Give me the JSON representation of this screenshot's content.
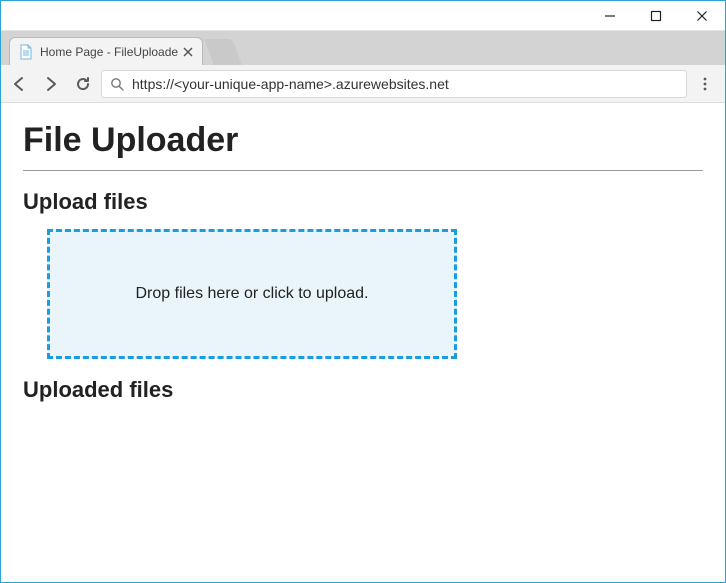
{
  "window": {
    "tab_title": "Home Page - FileUploade",
    "address_url": "https://<your-unique-app-name>.azurewebsites.net"
  },
  "page": {
    "title": "File Uploader",
    "upload_section_heading": "Upload files",
    "dropzone_message": "Drop files here or click to upload.",
    "uploaded_section_heading": "Uploaded files"
  }
}
